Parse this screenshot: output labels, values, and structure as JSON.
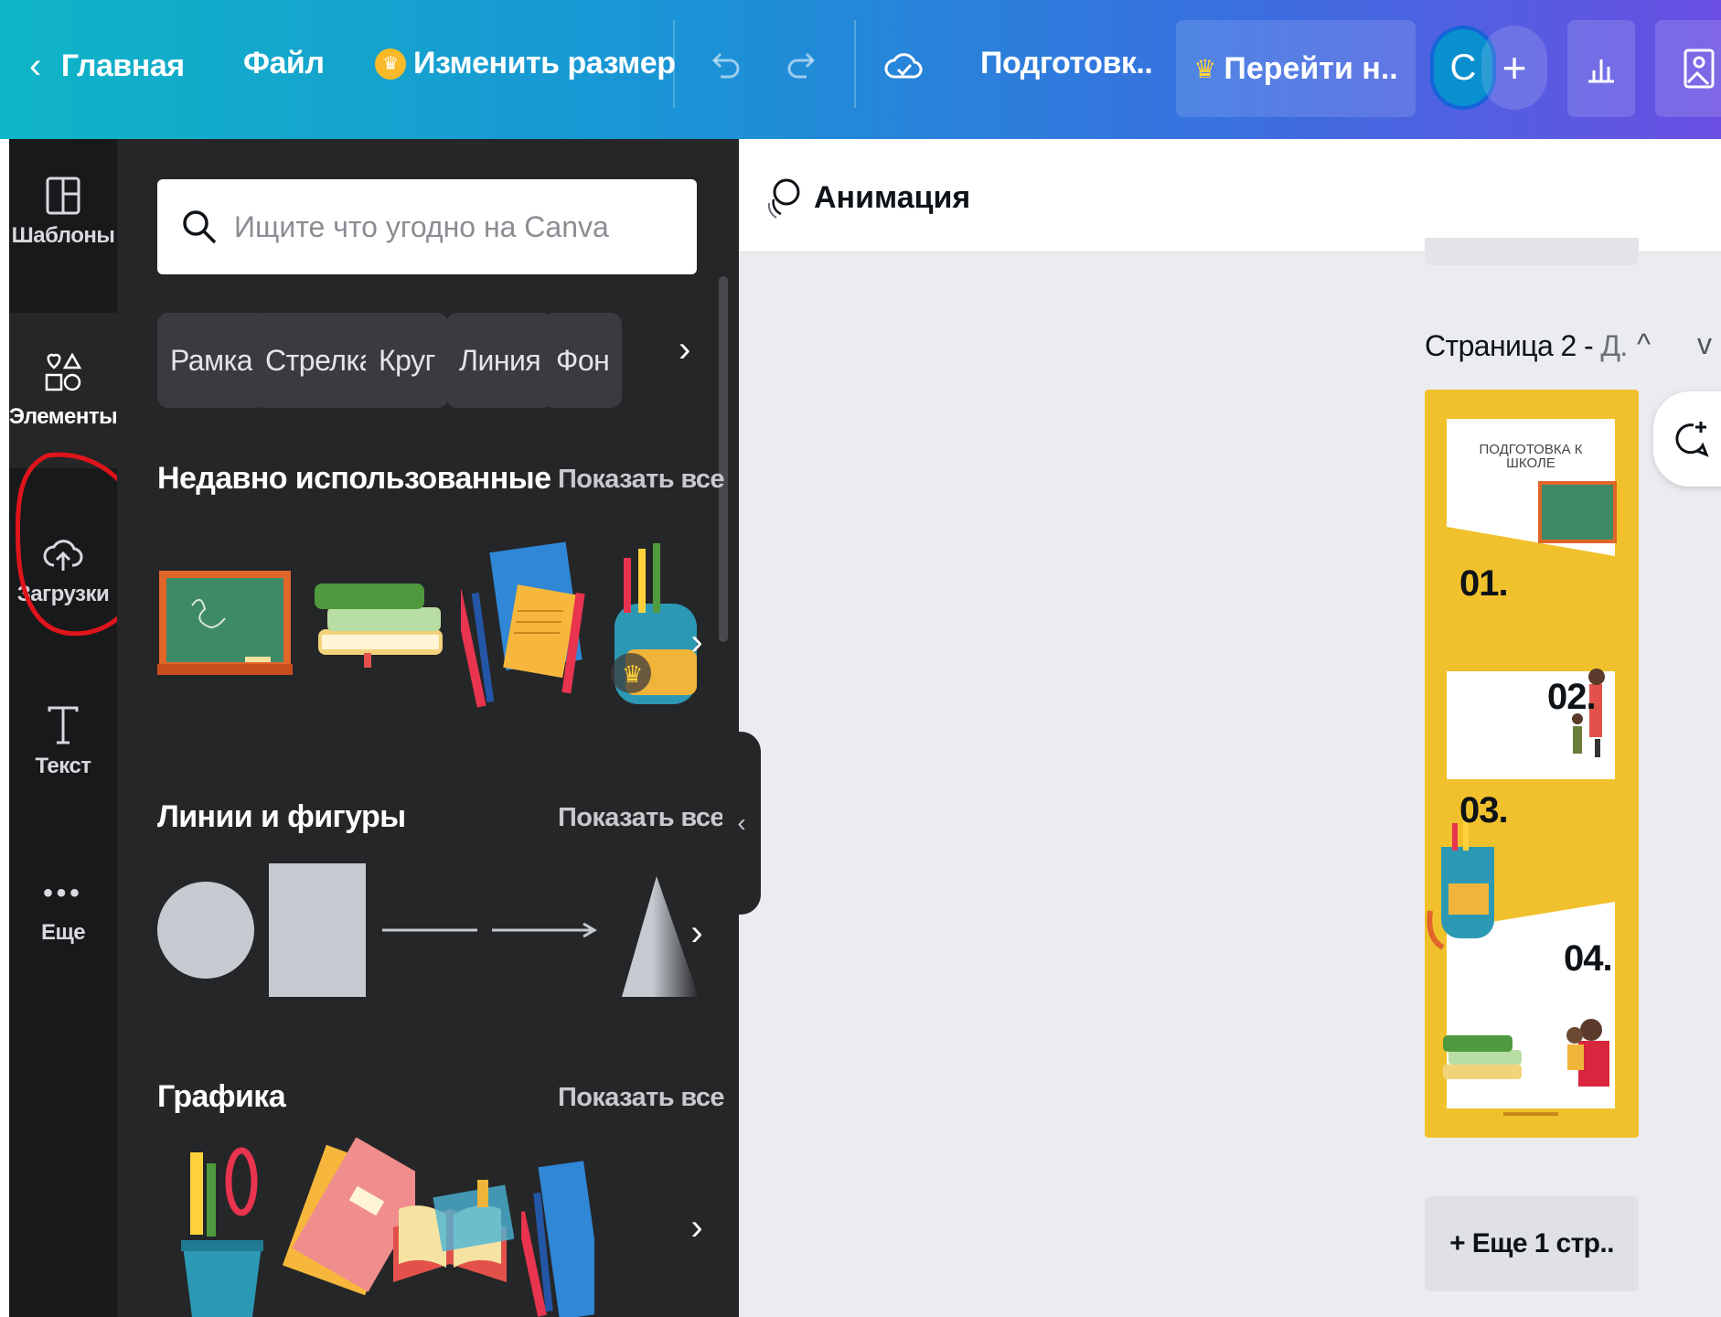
{
  "topbar": {
    "home_label": "Главная",
    "file_label": "Файл",
    "resize_label": "Изменить размер",
    "design_title": "Подготовк..",
    "upgrade_label": "Перейти н..",
    "avatar_letter": "С",
    "add_label": "+"
  },
  "rail": {
    "templates": "Шаблоны",
    "elements": "Элементы",
    "uploads": "Загрузки",
    "text": "Текст",
    "more": "Еще"
  },
  "panel": {
    "search_placeholder": "Ищите что угодно на Canva",
    "chips": [
      "Рамка",
      "Стрелка",
      "Круг",
      "Линия",
      "Фон"
    ],
    "sections": {
      "recent": {
        "title": "Недавно использованные",
        "link": "Показать все"
      },
      "lines": {
        "title": "Линии и фигуры",
        "link": "Показать все"
      },
      "graphics": {
        "title": "Графика",
        "link": "Показать все"
      }
    }
  },
  "canvas": {
    "animation_label": "Анимация",
    "page_label": "Страница 2 - ",
    "page_label_muted": "Д.",
    "more_pages": "+ Еще 1 стр..",
    "thumb": {
      "heading": "ПОДГОТОВКА К ШКОЛЕ",
      "steps": [
        "01.",
        "02.",
        "03.",
        "04."
      ]
    }
  },
  "colors": {
    "accent_gradient_start": "#0fb5c6",
    "accent_gradient_end": "#6a4fe2",
    "panel_bg": "#252628",
    "rail_bg": "#18191b",
    "highlight_circle": "#e0141b",
    "thumb_yellow": "#f0c12c"
  }
}
